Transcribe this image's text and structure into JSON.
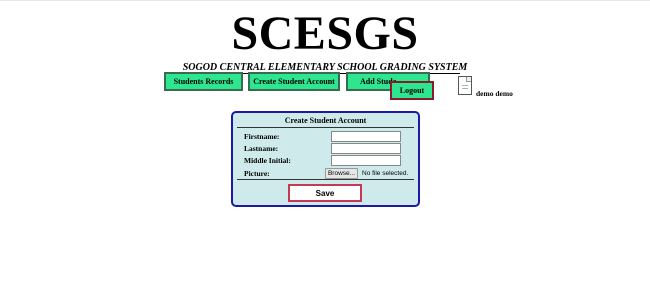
{
  "app": {
    "title": "SCESGS",
    "subtitle": "SOGOD CENTRAL ELEMENTARY SCHOOL GRADING SYSTEM"
  },
  "nav": {
    "students_records": "Students Records",
    "create_student_account": "Create Student Account",
    "add_student": "Add Stude",
    "logout": "Logout"
  },
  "user": {
    "name": "demo demo",
    "avatar_icon": "broken-image-icon"
  },
  "form": {
    "title": "Create Student Account",
    "fields": {
      "firstname": {
        "label": "Firstname:",
        "value": ""
      },
      "lastname": {
        "label": "Lastname:",
        "value": ""
      },
      "middle_initial": {
        "label": "Middle Initial:",
        "value": ""
      },
      "picture": {
        "label": "Picture:",
        "browse_label": "Browse...",
        "status": "No file selected."
      }
    },
    "save_label": "Save"
  },
  "colors": {
    "nav_button": "#2ee68f",
    "panel_bg": "#cfeaea",
    "panel_border": "#1a1aa8",
    "logout_border": "#8b1a2a",
    "save_border": "#c43a55"
  }
}
